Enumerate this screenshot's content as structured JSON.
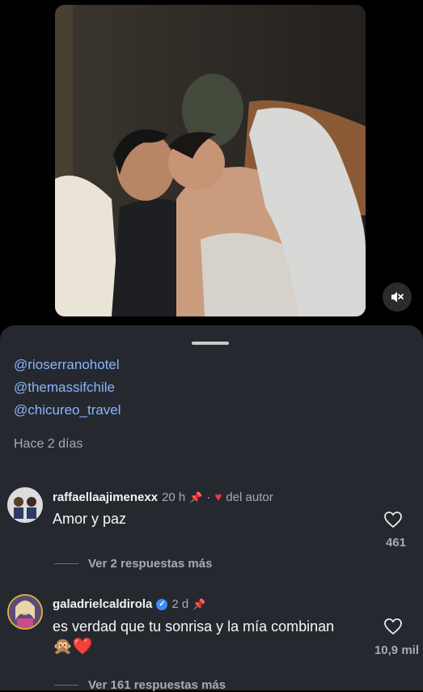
{
  "post": {
    "photo_alt": "Couple selfie on a sofa",
    "mute_icon": "speaker-muted-icon"
  },
  "caption": {
    "mentions": [
      "@rioserranohotel",
      "@themassifchile",
      "@chicureo_travel"
    ],
    "time_ago": "Hace 2 días"
  },
  "comments": [
    {
      "username": "raffaellaajimenexx",
      "time": "20 h",
      "author_like_label": "del autor",
      "text": "Amor y paz",
      "likes": "461",
      "replies_label": "Ver 2 respuestas más"
    },
    {
      "username": "galadrielcaldirola",
      "time": "2 d",
      "verified_glyph": "✓",
      "text": "es verdad que tu sonrisa y la mía combinan",
      "emojis": "🙊❤️",
      "likes": "10,9 mil",
      "replies_label": "Ver 161 respuestas más"
    }
  ],
  "colors": {
    "sheet_bg": "#25292f",
    "mention": "#8ab4ff",
    "verified": "#3b8cf4",
    "author_heart": "#ff3040"
  }
}
